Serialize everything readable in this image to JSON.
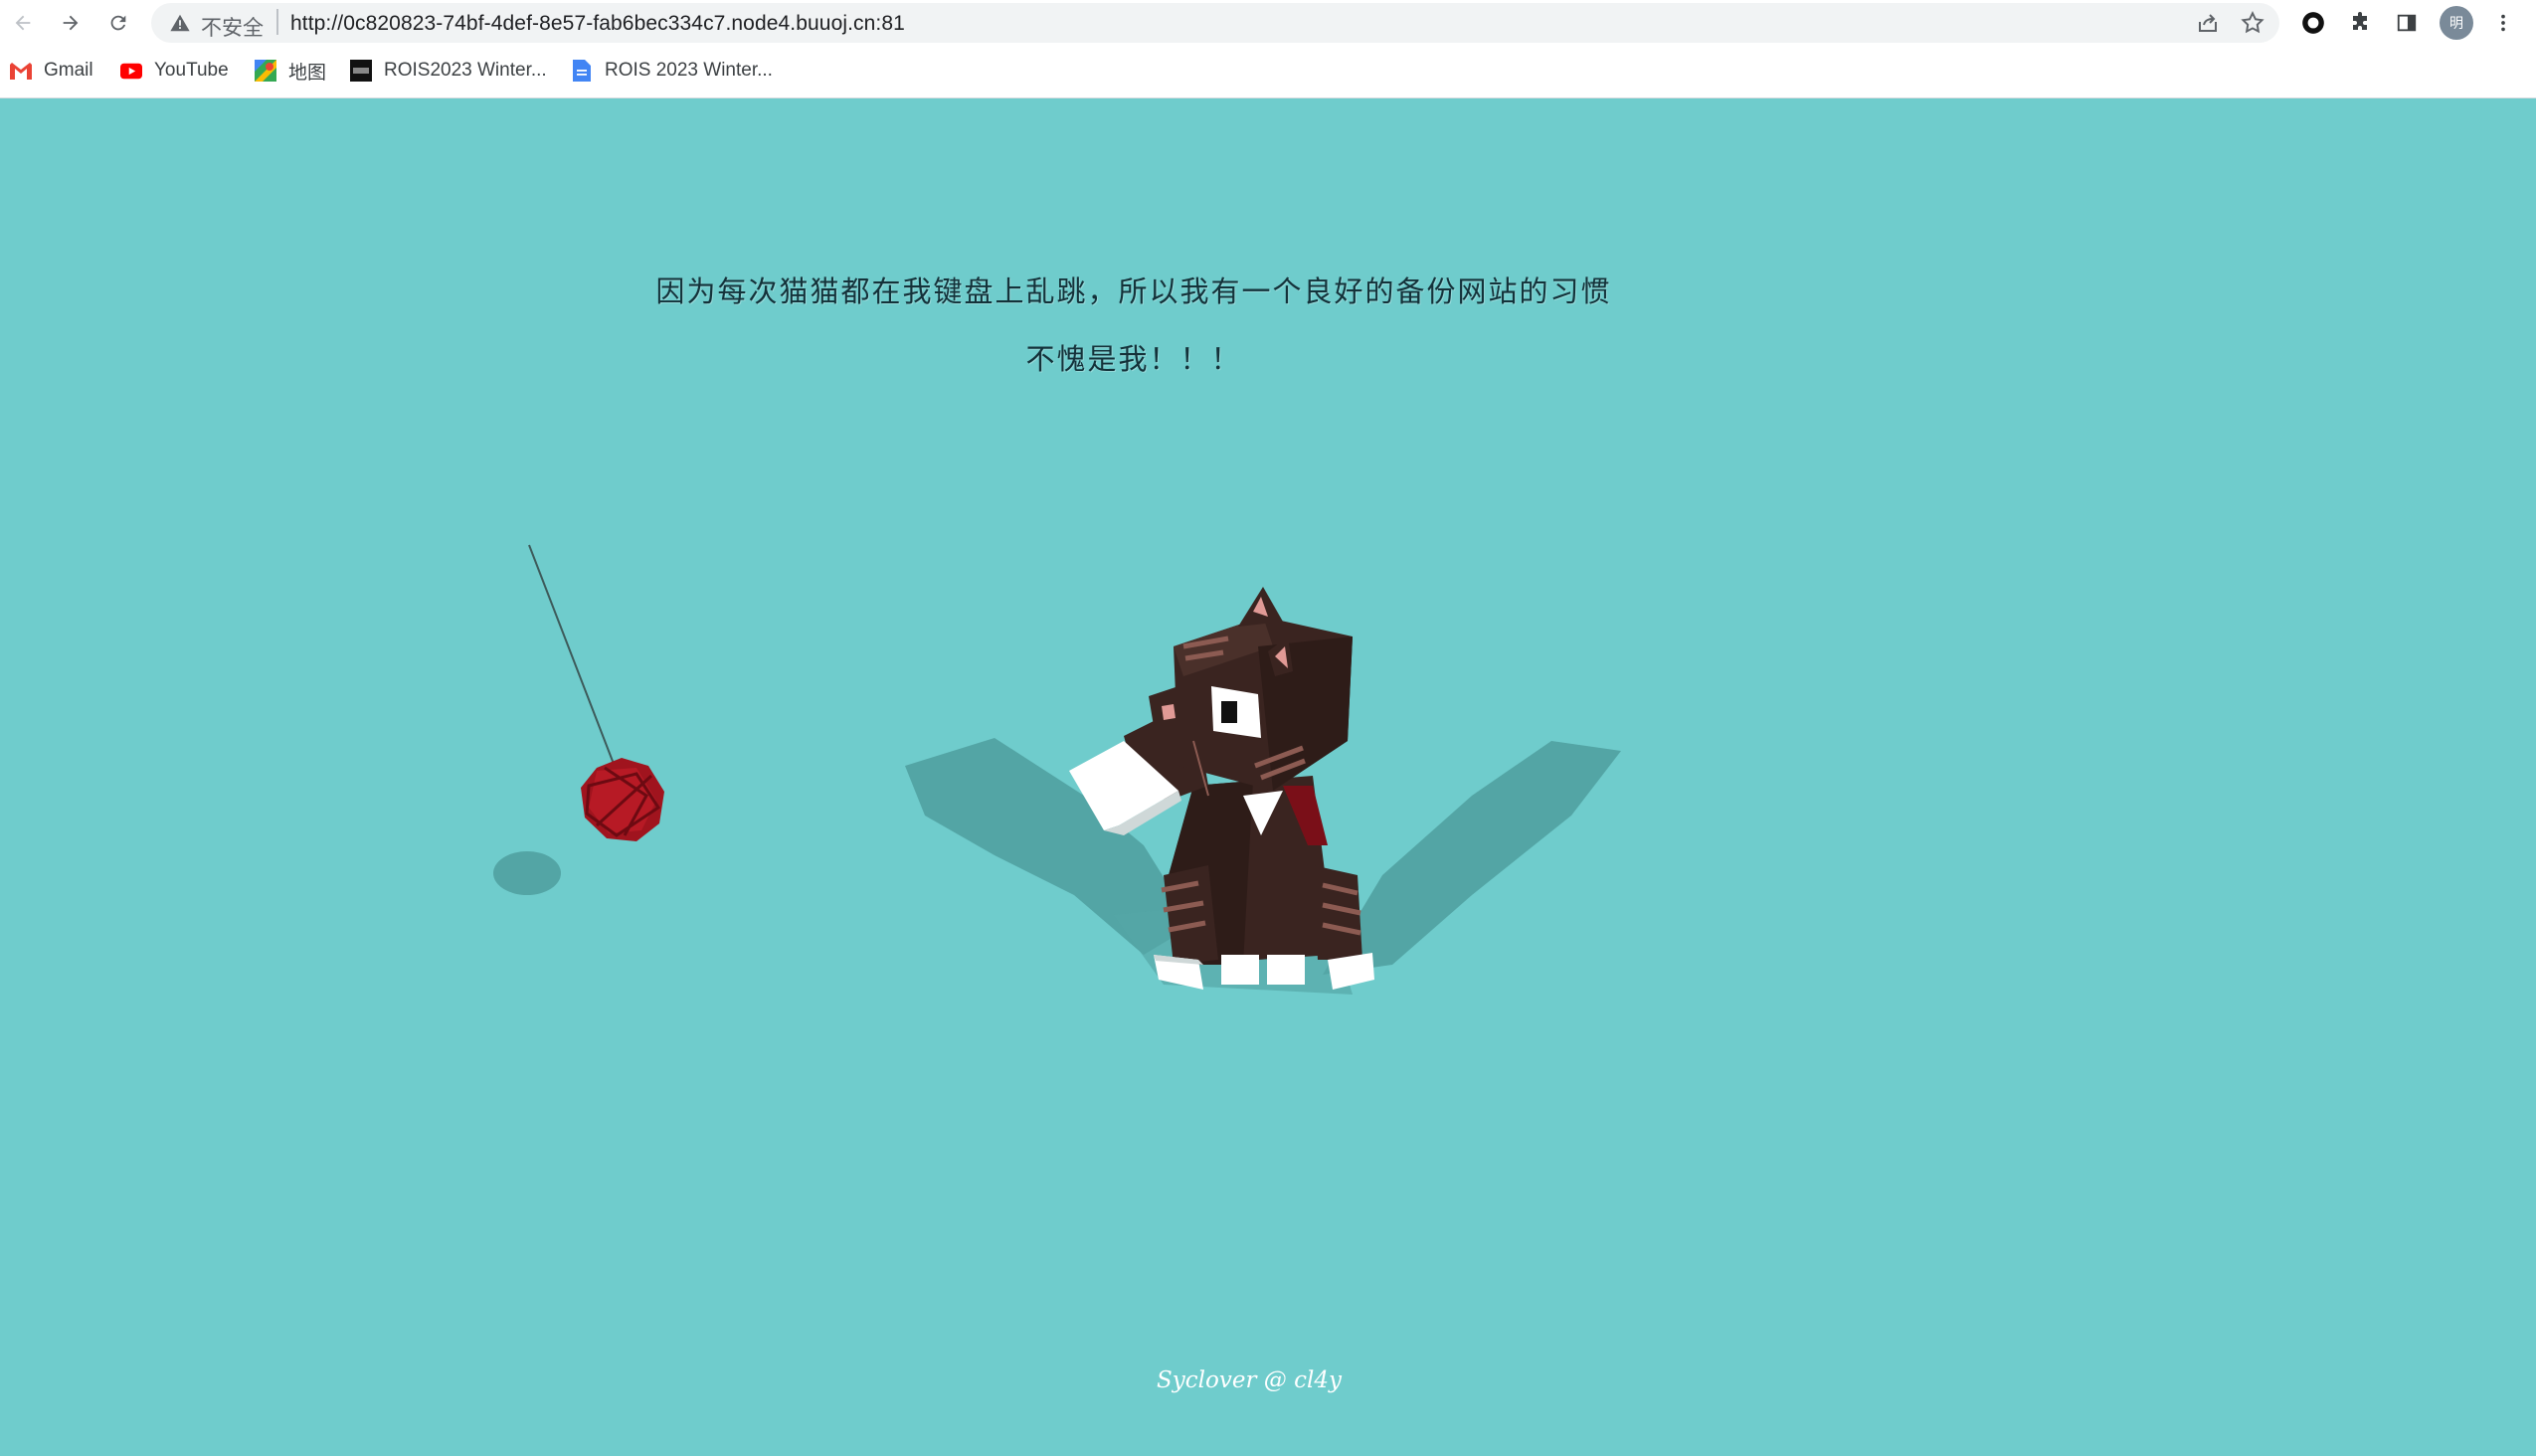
{
  "browser": {
    "security_label": "不安全",
    "url": "http://0c820823-74bf-4def-8e57-fab6bec334c7.node4.buuoj.cn:81",
    "avatar_label": "明",
    "bookmarks": [
      {
        "label": "Gmail",
        "icon": "gmail-icon"
      },
      {
        "label": "YouTube",
        "icon": "youtube-icon"
      },
      {
        "label": "地图",
        "icon": "maps-icon"
      },
      {
        "label": "ROIS2023 Winter...",
        "icon": "rois-icon"
      },
      {
        "label": "ROIS 2023 Winter...",
        "icon": "docs-icon"
      }
    ]
  },
  "page": {
    "headline_line1": "因为每次猫猫都在我键盘上乱跳，所以我有一个良好的备份网站的习惯",
    "headline_line2": "不愧是我！！！",
    "footer": "Syclover @ cl4y"
  },
  "colors": {
    "background": "#6fcccc",
    "cat_fur": "#3a2420",
    "yarn": "#a0141e"
  }
}
